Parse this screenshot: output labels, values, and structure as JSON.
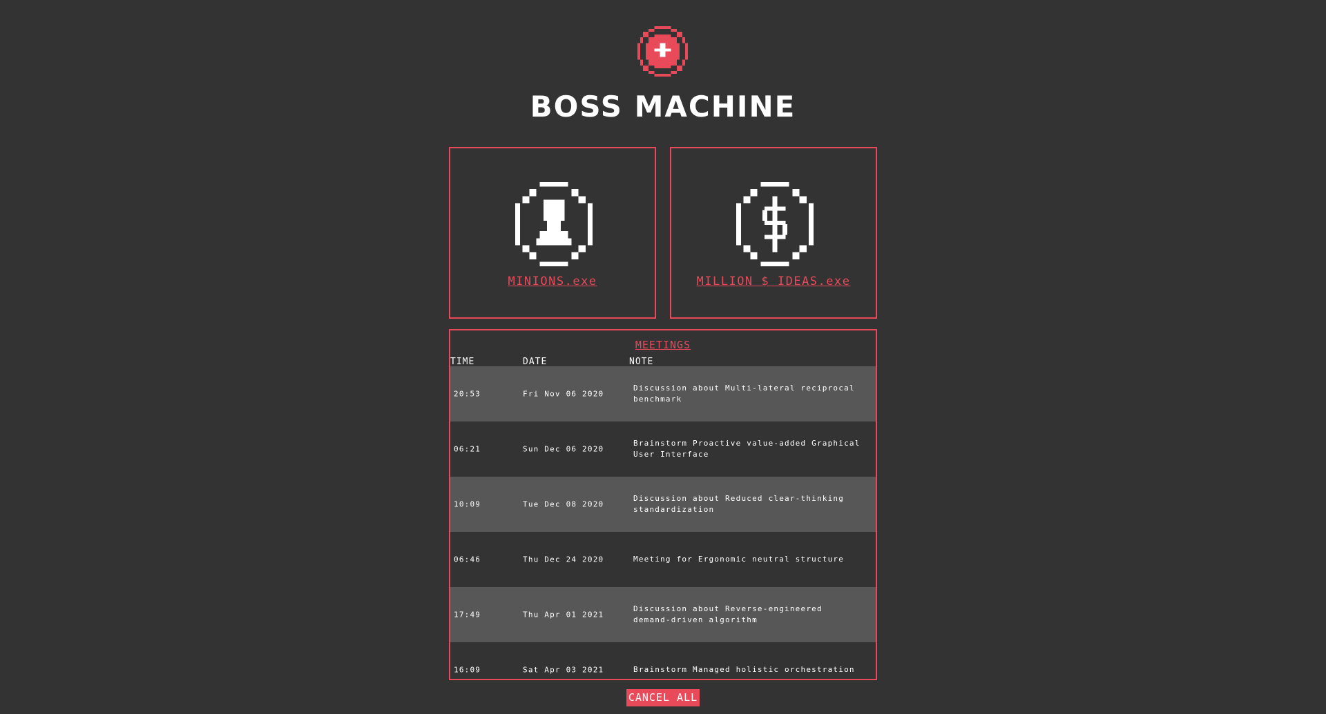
{
  "app": {
    "title": "BOSS MACHINE"
  },
  "logo": {
    "icon": "red-orb-icon",
    "color": "#e84a5a"
  },
  "cards": [
    {
      "icon": "minion-icon",
      "label": "MINIONS.exe"
    },
    {
      "icon": "dollar-coin-icon",
      "label": "MILLION $ IDEAS.exe"
    }
  ],
  "meetings": {
    "title": "MEETINGS",
    "columns": [
      "TIME",
      "DATE",
      "NOTE"
    ],
    "rows": [
      {
        "time": "20:53",
        "date": "Fri Nov 06 2020",
        "note": "Discussion about Multi-lateral reciprocal benchmark"
      },
      {
        "time": "06:21",
        "date": "Sun Dec 06 2020",
        "note": "Brainstorm Proactive value-added Graphical User Interface"
      },
      {
        "time": "10:09",
        "date": "Tue Dec 08 2020",
        "note": "Discussion about Reduced clear-thinking standardization"
      },
      {
        "time": "06:46",
        "date": "Thu Dec 24 2020",
        "note": "Meeting for Ergonomic neutral structure"
      },
      {
        "time": "17:49",
        "date": "Thu Apr 01 2021",
        "note": "Discussion about Reverse-engineered demand-driven algorithm"
      },
      {
        "time": "16:09",
        "date": "Sat Apr 03 2021",
        "note": "Brainstorm Managed holistic orchestration"
      }
    ]
  },
  "actions": {
    "cancel_all": "CANCEL ALL"
  },
  "colors": {
    "background": "#333333",
    "accent": "#e84a5a",
    "row_shade": "#575757",
    "text": "#ffffff"
  }
}
